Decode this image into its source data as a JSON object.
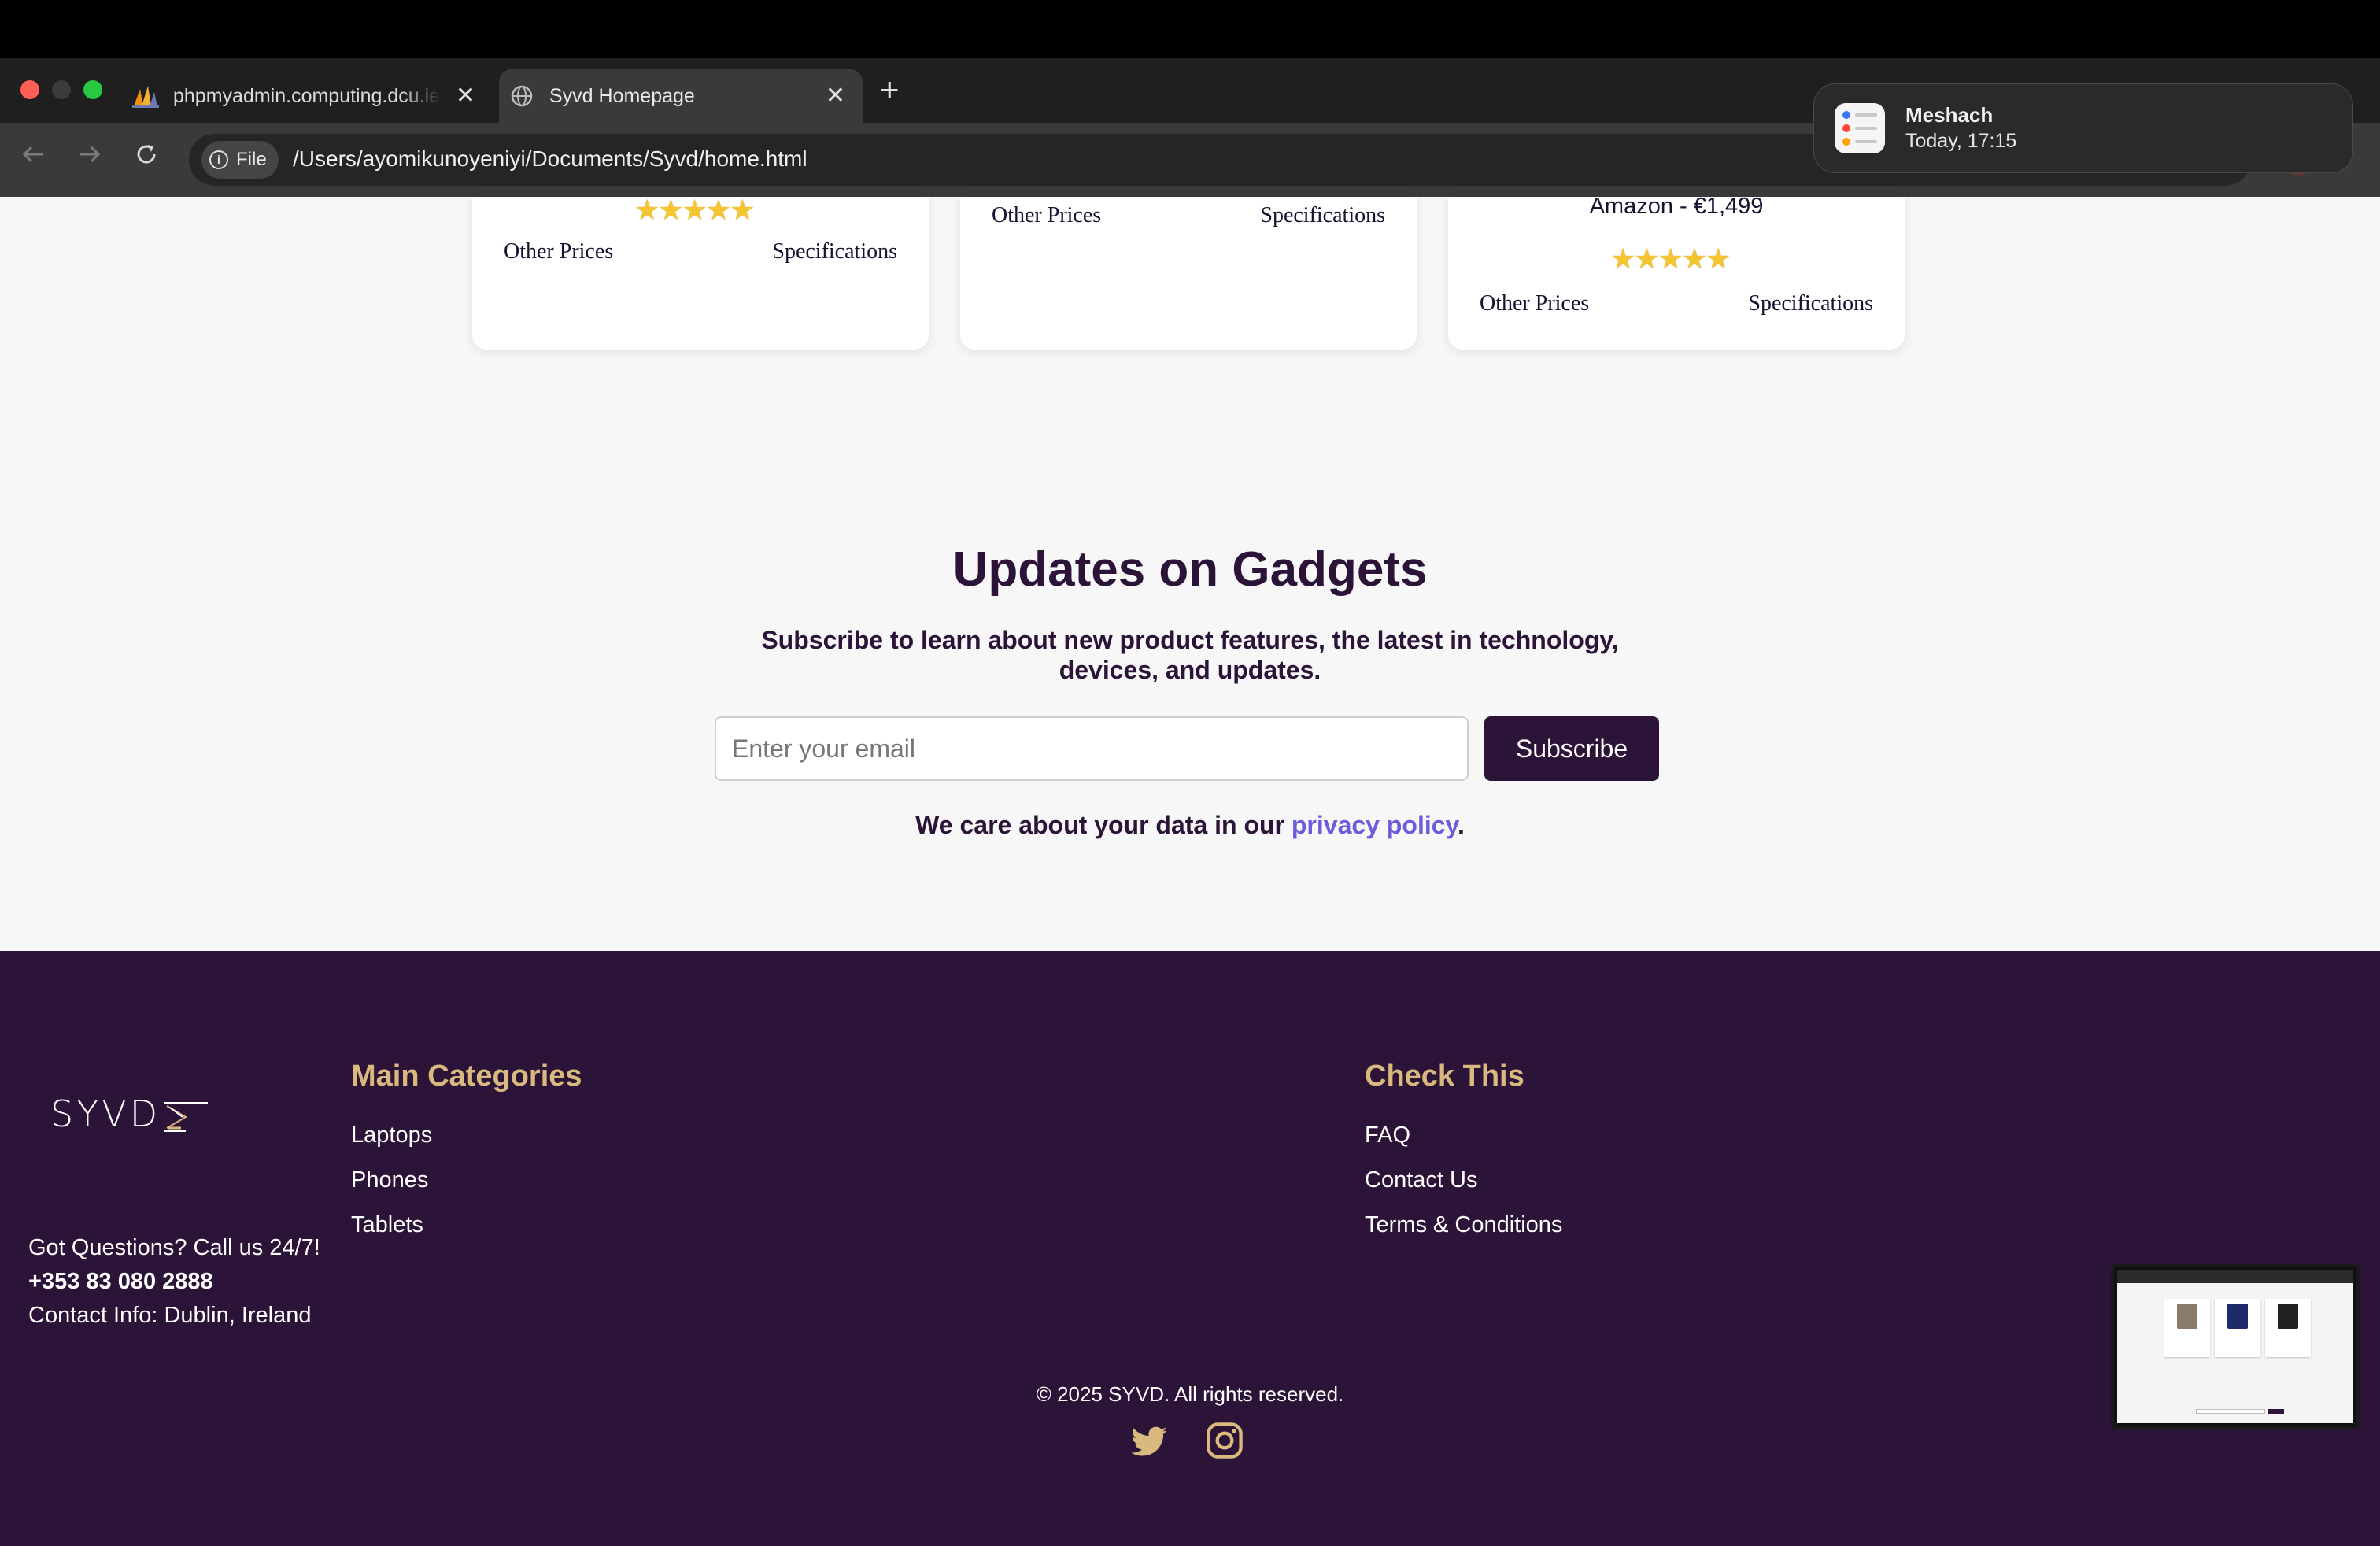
{
  "browser": {
    "tabs": [
      {
        "title": "phpmyadmin.computing.dcu.ie",
        "active": false
      },
      {
        "title": "Syvd Homepage",
        "active": true
      }
    ],
    "new_tab_symbol": "+",
    "close_symbol": "✕",
    "file_chip_label": "File",
    "url": "/Users/ayomikunoyeniyi/Documents/Syvd/home.html"
  },
  "notification": {
    "title": "Meshach",
    "subtitle": "Today, 17:15",
    "icon": "reminders-icon"
  },
  "cards": [
    {
      "stars": "★★★★★",
      "other_prices": "Other Prices",
      "specifications": "Specifications",
      "rating": 5
    },
    {
      "other_prices": "Other Prices",
      "specifications": "Specifications"
    },
    {
      "price": "Amazon - €1,499",
      "stars": "★★★★★",
      "other_prices": "Other Prices",
      "specifications": "Specifications",
      "rating": 5
    }
  ],
  "newsletter": {
    "title": "Updates on Gadgets",
    "subtitle": "Subscribe to learn about new product features, the latest in technology, devices, and updates.",
    "email_placeholder": "Enter your email",
    "subscribe_label": "Subscribe",
    "privacy_prefix": "We care about your data in our ",
    "privacy_link": "privacy policy",
    "privacy_suffix": "."
  },
  "footer": {
    "logo_text": "SYVD",
    "contact_question": "Got Questions? Call us 24/7!",
    "phone": "+353 83 080 2888",
    "contact_info": "Contact Info: Dublin, Ireland",
    "main_categories": {
      "title": "Main Categories",
      "links": [
        "Laptops",
        "Phones",
        "Tablets"
      ]
    },
    "check_this": {
      "title": "Check This",
      "links": [
        "FAQ",
        "Contact Us",
        "Terms & Conditions"
      ]
    },
    "copyright": "© 2025 SYVD. All rights reserved.",
    "social": [
      "twitter-icon",
      "instagram-icon"
    ]
  },
  "colors": {
    "brand_dark": "#2c1338",
    "accent_gold": "#d9b97e",
    "link_purple": "#6a5cdc",
    "star_gold": "#f4c531"
  }
}
